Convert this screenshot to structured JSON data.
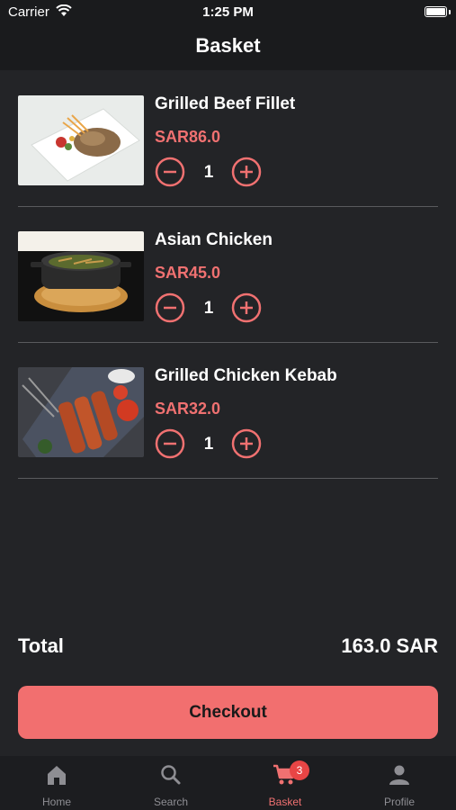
{
  "status_bar": {
    "carrier": "Carrier",
    "time": "1:25 PM"
  },
  "nav": {
    "title": "Basket"
  },
  "items": [
    {
      "name": "Grilled Beef Fillet",
      "price": "SAR86.0",
      "quantity": "1"
    },
    {
      "name": "Asian Chicken",
      "price": "SAR45.0",
      "quantity": "1"
    },
    {
      "name": "Grilled Chicken Kebab",
      "price": "SAR32.0",
      "quantity": "1"
    }
  ],
  "total": {
    "label": "Total",
    "value": "163.0 SAR"
  },
  "checkout": {
    "label": "Checkout"
  },
  "tabs": [
    {
      "label": "Home",
      "icon": "home-icon"
    },
    {
      "label": "Search",
      "icon": "search-icon"
    },
    {
      "label": "Basket",
      "icon": "cart-icon",
      "badge": "3"
    },
    {
      "label": "Profile",
      "icon": "person-icon"
    }
  ],
  "colors": {
    "accent": "#f26f6f",
    "price": "#f07171",
    "background": "#232427",
    "badge": "#e84545"
  }
}
